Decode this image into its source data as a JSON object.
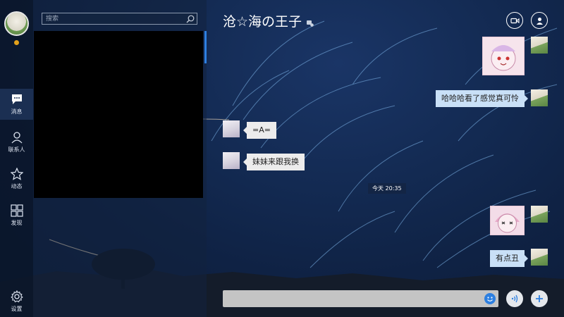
{
  "nav": {
    "items": [
      {
        "label": "消息",
        "icon": "chat-bubble-icon",
        "active": true
      },
      {
        "label": "联系人",
        "icon": "person-icon"
      },
      {
        "label": "动态",
        "icon": "star-icon"
      },
      {
        "label": "发现",
        "icon": "grid-icon"
      }
    ],
    "settings_label": "设置"
  },
  "search": {
    "placeholder": "搜索"
  },
  "chat": {
    "title": "沧☆海の王子",
    "messages": [
      {
        "direction": "out",
        "kind": "sticker"
      },
      {
        "direction": "out",
        "kind": "text",
        "text": "哈哈哈看了感觉真可怜"
      },
      {
        "direction": "in",
        "kind": "text",
        "text": "=A="
      },
      {
        "direction": "in",
        "kind": "text",
        "text": "妹妹来跟我换"
      },
      {
        "direction": "out",
        "kind": "sticker"
      },
      {
        "direction": "out",
        "kind": "text",
        "text": "有点丑"
      }
    ],
    "timestamp": "今天 20:35"
  },
  "colors": {
    "accent": "#2d7fe0",
    "status_dot": "#e3a11b",
    "bubble_out": "#c9e0f7",
    "bubble_in": "#ececec"
  }
}
